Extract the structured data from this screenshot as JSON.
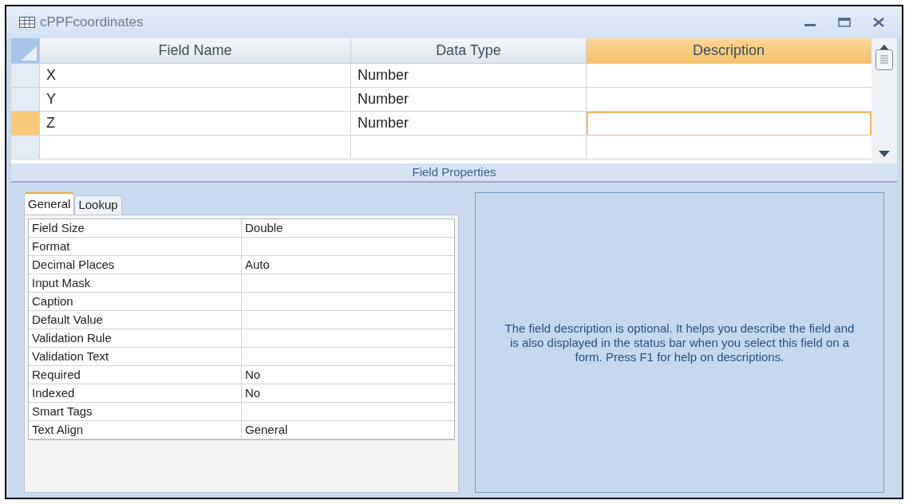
{
  "window": {
    "title": "cPPFcoordinates"
  },
  "grid": {
    "columns": [
      {
        "label": "Field Name",
        "selected": false
      },
      {
        "label": "Data Type",
        "selected": false
      },
      {
        "label": "Description",
        "selected": true
      }
    ],
    "rows": [
      {
        "field_name": "X",
        "data_type": "Number",
        "selected": false
      },
      {
        "field_name": "Y",
        "data_type": "Number",
        "selected": false
      },
      {
        "field_name": "Z",
        "data_type": "Number",
        "selected": true
      },
      {
        "selected": false
      }
    ]
  },
  "field_properties": {
    "title": "Field Properties",
    "tabs": [
      {
        "label": "General",
        "selected": true
      },
      {
        "label": "Lookup",
        "selected": false
      }
    ],
    "properties": [
      {
        "name": "Field Size",
        "value": "Double"
      },
      {
        "name": "Format"
      },
      {
        "name": "Decimal Places",
        "value": "Auto"
      },
      {
        "name": "Input Mask"
      },
      {
        "name": "Caption"
      },
      {
        "name": "Default Value"
      },
      {
        "name": "Validation Rule"
      },
      {
        "name": "Validation Text"
      },
      {
        "name": "Required",
        "value": "No"
      },
      {
        "name": "Indexed",
        "value": "No"
      },
      {
        "name": "Smart Tags"
      },
      {
        "name": "Text Align",
        "value": "General"
      }
    ],
    "help_text": "The field description is optional.  It helps you describe the field and is also displayed in the status bar when you select this field on a form.  Press F1 for help on descriptions."
  }
}
